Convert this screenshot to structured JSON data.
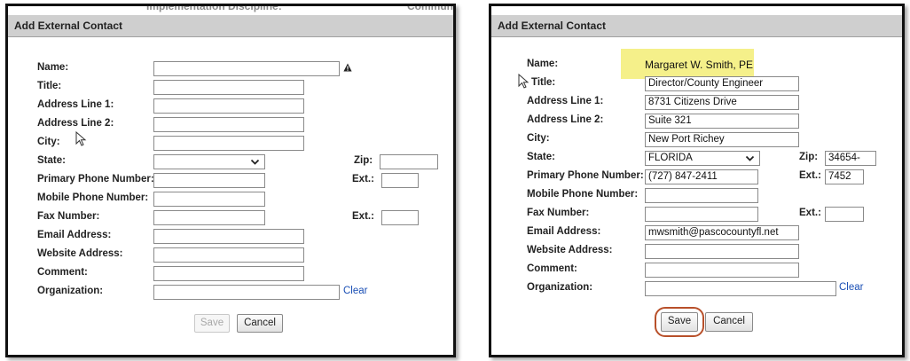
{
  "left": {
    "bg_fragment_1": "Implementation Discipline:",
    "bg_fragment_2": "Communic",
    "dialog_title": "Add External Contact",
    "labels": {
      "name": "Name:",
      "title": "Title:",
      "address1": "Address Line 1:",
      "address2": "Address Line 2:",
      "city": "City:",
      "state": "State:",
      "zip": "Zip:",
      "primary_phone": "Primary Phone Number:",
      "ext1": "Ext.:",
      "mobile_phone": "Mobile Phone Number:",
      "fax": "Fax Number:",
      "ext2": "Ext.:",
      "email": "Email Address:",
      "website": "Website Address:",
      "comment": "Comment:",
      "organization": "Organization:"
    },
    "values": {
      "name": "",
      "title": "",
      "address1": "",
      "address2": "",
      "city": "",
      "state": "",
      "zip": "",
      "primary_phone": "",
      "ext1": "",
      "mobile_phone": "",
      "fax": "",
      "ext2": "",
      "email": "",
      "website": "",
      "comment": "",
      "organization": ""
    },
    "clear_label": "Clear",
    "save_label": "Save",
    "cancel_label": "Cancel",
    "save_disabled": true,
    "name_warning_icon": "warning-icon"
  },
  "right": {
    "dialog_title": "Add External Contact",
    "labels": {
      "name": "Name:",
      "title": "Title:",
      "address1": "Address Line 1:",
      "address2": "Address Line 2:",
      "city": "City:",
      "state": "State:",
      "zip": "Zip:",
      "primary_phone": "Primary Phone Number:",
      "ext1": "Ext.:",
      "mobile_phone": "Mobile Phone Number:",
      "fax": "Fax Number:",
      "ext2": "Ext.:",
      "email": "Email Address:",
      "website": "Website Address:",
      "comment": "Comment:",
      "organization": "Organization:"
    },
    "values": {
      "name": "Margaret W. Smith, PE",
      "title": "Director/County Engineer",
      "address1": "8731 Citizens Drive",
      "address2": "Suite 321",
      "city": "New Port Richey",
      "state": "FLORIDA",
      "zip": "34654-",
      "primary_phone": "(727) 847-2411",
      "ext1": "7452",
      "mobile_phone": "",
      "fax": "",
      "ext2": "",
      "email": "mwsmith@pascocountyfl.net",
      "website": "",
      "comment": "",
      "organization": ""
    },
    "clear_label": "Clear",
    "save_label": "Save",
    "cancel_label": "Cancel",
    "name_highlight_color": "#f5f08a",
    "save_ring_color": "#b8502a"
  }
}
